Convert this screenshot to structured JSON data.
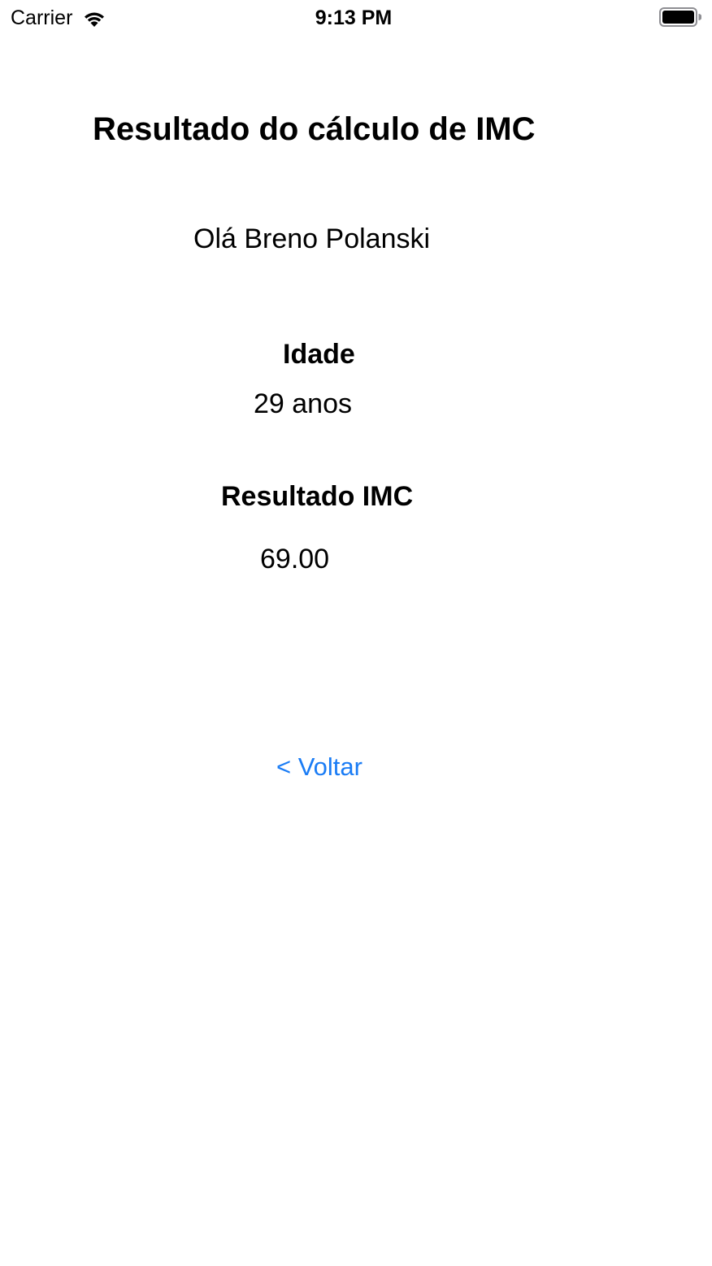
{
  "status_bar": {
    "carrier": "Carrier",
    "time": "9:13 PM",
    "wifi_icon": "wifi-icon",
    "battery_icon": "battery-full-icon",
    "battery_level": 1.0
  },
  "screen": {
    "title": "Resultado do cálculo de IMC",
    "greeting": "Olá Breno Polanski",
    "age_label": "Idade",
    "age_value": "29 anos",
    "imc_label": "Resultado IMC",
    "imc_value": "69.00",
    "back_label": "< Voltar"
  },
  "colors": {
    "accent": "#1a7cf5",
    "text": "#000000",
    "background": "#ffffff"
  }
}
